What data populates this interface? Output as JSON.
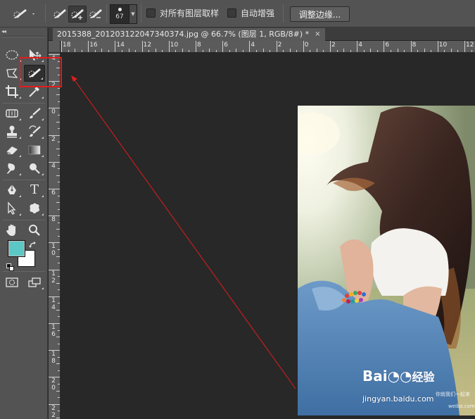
{
  "options_bar": {
    "brush_size": "67",
    "sample_all_layers_label": "对所有图层取样",
    "sample_all_layers_checked": false,
    "auto_enhance_label": "自动增强",
    "auto_enhance_checked": false,
    "refine_edge_label": "调整边缘..."
  },
  "document_tab": {
    "title": "2015388_201203122047340374.jpg @ 66.7% (图层 1, RGB/8#) *",
    "close": "×"
  },
  "ruler_top_labels": [
    "18",
    "16",
    "14",
    "12",
    "10",
    "8",
    "6",
    "4",
    "2",
    "0",
    "2",
    "4",
    "6",
    "8",
    "10",
    "12"
  ],
  "ruler_left_labels": [
    "4",
    "2",
    "0",
    "2",
    "4",
    "6",
    "8",
    "1\n0",
    "1\n2",
    "1\n4",
    "1\n6",
    "1\n8",
    "2\n0",
    "2\n2"
  ],
  "toolbox": {
    "collapse_label": "◂◂",
    "tools": [
      {
        "name": "marquee-tool",
        "icon": "ellipse-marquee-icon"
      },
      {
        "name": "move-tool",
        "icon": "move-icon"
      },
      {
        "name": "lasso-tool",
        "icon": "polygon-lasso-icon"
      },
      {
        "name": "quick-selection-tool",
        "icon": "quick-selection-brush-icon",
        "active": true
      },
      {
        "name": "crop-tool",
        "icon": "crop-icon"
      },
      {
        "name": "eyedropper-tool",
        "icon": "eyedropper-icon"
      },
      {
        "name": "healing-brush-tool",
        "icon": "bandage-icon"
      },
      {
        "name": "brush-tool",
        "icon": "brush-icon"
      },
      {
        "name": "clone-stamp-tool",
        "icon": "stamp-icon"
      },
      {
        "name": "history-brush-tool",
        "icon": "history-brush-icon"
      },
      {
        "name": "eraser-tool",
        "icon": "eraser-icon"
      },
      {
        "name": "gradient-tool",
        "icon": "gradient-icon"
      },
      {
        "name": "blur-tool",
        "icon": "smudge-icon"
      },
      {
        "name": "dodge-tool",
        "icon": "dodge-icon"
      },
      {
        "name": "pen-tool",
        "icon": "pen-icon"
      },
      {
        "name": "type-tool",
        "icon": "type-icon",
        "glyph": "T"
      },
      {
        "name": "path-selection-tool",
        "icon": "arrow-cursor-icon"
      },
      {
        "name": "custom-shape-tool",
        "icon": "custom-shape-icon"
      },
      {
        "name": "hand-tool",
        "icon": "hand-icon"
      },
      {
        "name": "zoom-tool",
        "icon": "zoom-icon"
      }
    ],
    "foreground_color": "#5bc8c5",
    "background_color": "#ffffff"
  },
  "watermark": {
    "brand_left": "Bai",
    "brand_right": "经验",
    "url": "jingyan.baidu.com",
    "side_text": "你就我们一起来",
    "site": "weibo.com"
  },
  "colors": {
    "annotation_red": "#e01c1c",
    "panel_bg": "#535353",
    "canvas_bg": "#282828"
  }
}
